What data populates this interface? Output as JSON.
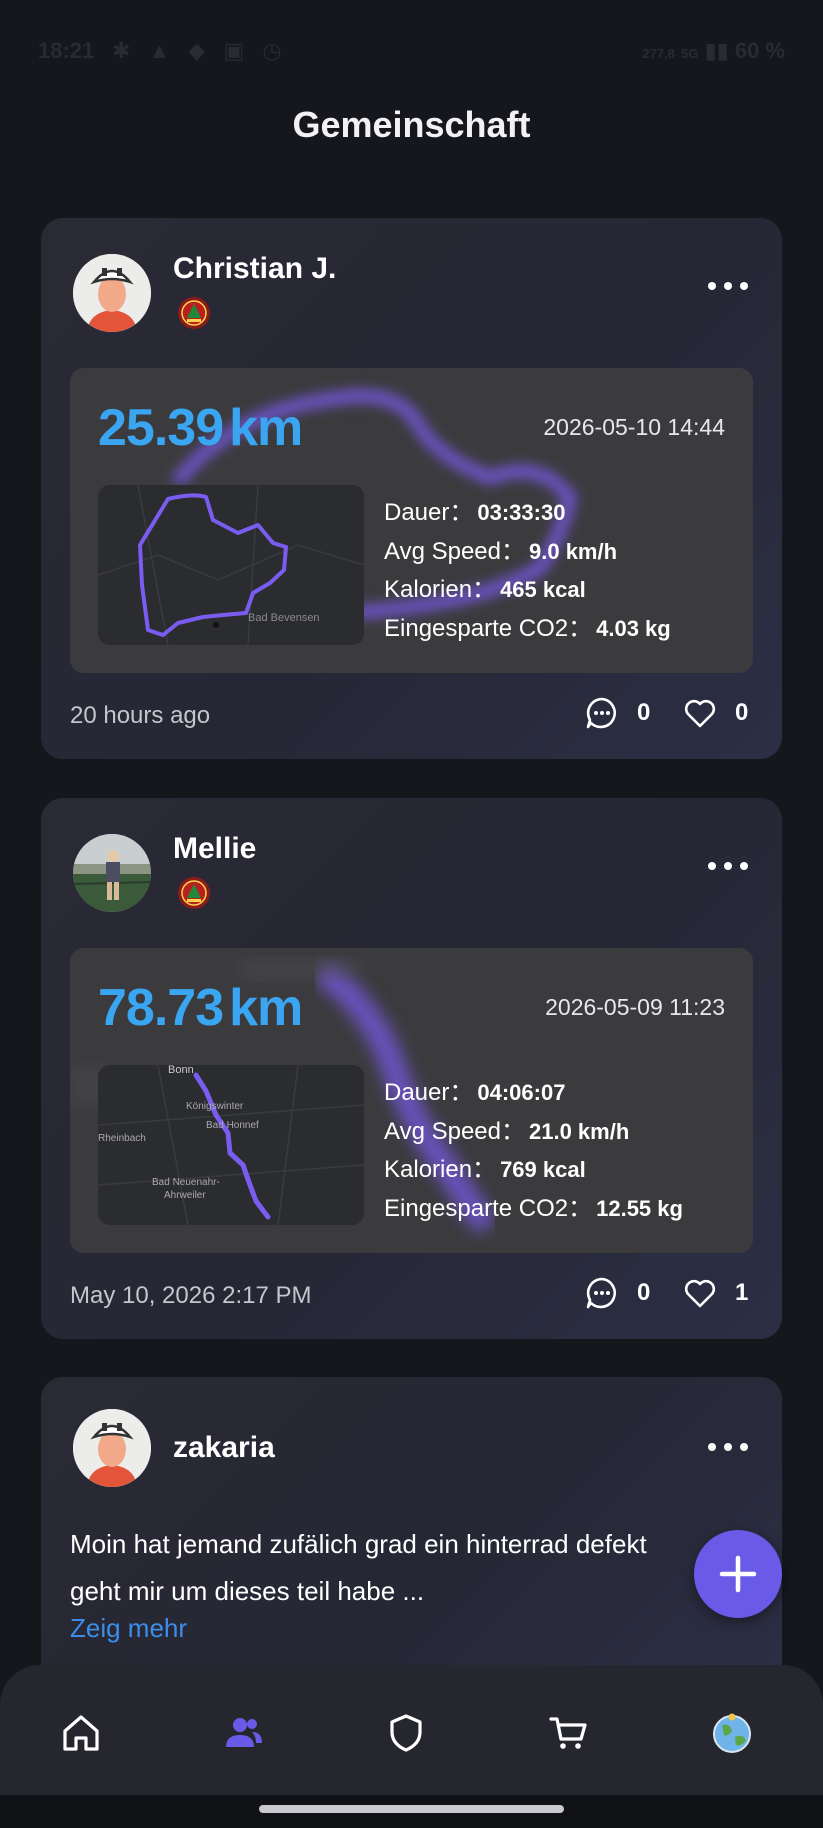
{
  "status_bar": {
    "time": "18:21",
    "network_speed": "277,8",
    "network_unit": "kB/s",
    "network_type": "5G",
    "battery": "60 %"
  },
  "page": {
    "title": "Gemeinschaft"
  },
  "posts": [
    {
      "username": "Christian J.",
      "ride": {
        "distance": "25.39",
        "distance_unit": "km",
        "date": "2026-05-10 14:44",
        "duration_label": "Dauer：",
        "duration": "03:33:30",
        "speed_label": "Avg Speed：",
        "speed": "9.0 km/h",
        "calories_label": "Kalorien：",
        "calories": "465 kcal",
        "co2_label": "Eingesparte CO2：",
        "co2": "4.03 kg",
        "map_place": "Bad Bevensen"
      },
      "time": "20 hours ago",
      "comments": "0",
      "likes": "0"
    },
    {
      "username": "Mellie",
      "ride": {
        "distance": "78.73",
        "distance_unit": "km",
        "date": "2026-05-09 11:23",
        "duration_label": "Dauer：",
        "duration": "04:06:07",
        "speed_label": "Avg Speed：",
        "speed": "21.0 km/h",
        "calories_label": "Kalorien：",
        "calories": "769 kcal",
        "co2_label": "Eingesparte CO2：",
        "co2": "12.55 kg",
        "map_places": [
          "Bonn",
          "Königswinter",
          "Bad Honnef",
          "Rheinbach",
          "Bad Neuenahr-",
          "Ahrweiler"
        ]
      },
      "time": "May 10, 2026 2:17 PM",
      "comments": "0",
      "likes": "1"
    },
    {
      "username": "zakaria",
      "text_line1": "Moin hat jemand zufälich grad ein hinterrad defekt",
      "text_line2": "geht mir um dieses teil  habe ...",
      "show_more": "Zeig mehr"
    }
  ],
  "nav": {
    "items": [
      "home-icon",
      "community-icon",
      "shield-icon",
      "cart-icon",
      "globe-icon"
    ],
    "active": "community-icon"
  },
  "colors": {
    "accent": "#6a5ae8",
    "distance": "#3aa6f2",
    "link": "#3a8ee8",
    "route": "#7b5cf0"
  }
}
